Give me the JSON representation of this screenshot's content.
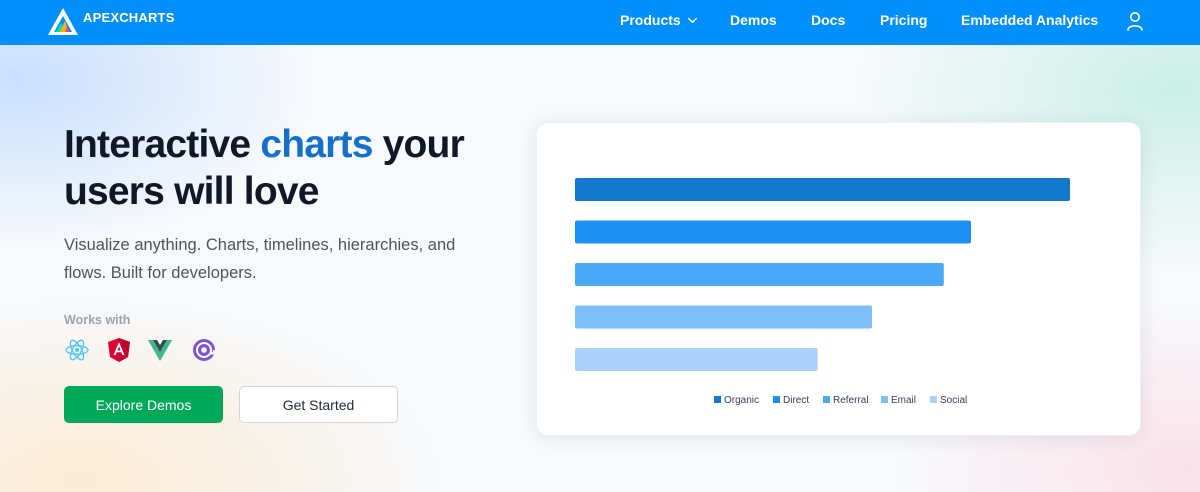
{
  "navbar": {
    "brand_name": "APEXCHARTS",
    "links": [
      {
        "label": "Products",
        "has_dropdown": true
      },
      {
        "label": "Demos"
      },
      {
        "label": "Docs"
      },
      {
        "label": "Pricing"
      },
      {
        "label": "Embedded Analytics"
      }
    ],
    "user_icon": "user-icon"
  },
  "hero": {
    "title_part1": "Interactive ",
    "title_accent": "charts",
    "title_part2": " your users will love",
    "subtitle": "Visualize anything. Charts, timelines, hierarchies, and flows. Built for developers.",
    "works_with_label": "Works with",
    "frameworks": [
      "react-icon",
      "angular-icon",
      "vue-icon",
      "blazor-icon"
    ],
    "primary_button": "Explore Demos",
    "secondary_button": "Get Started"
  },
  "colors": {
    "nav_bg": "#008ffb",
    "accent_text": "#1570c9",
    "primary_button": "#00a85a"
  },
  "chart_data": {
    "type": "bar",
    "orientation": "horizontal",
    "categories": [
      "Organic",
      "Direct",
      "Referral",
      "Email",
      "Social"
    ],
    "values": [
      100,
      80,
      74.5,
      60,
      49
    ],
    "colors": [
      "#1479cc",
      "#1e90f5",
      "#4aa9f7",
      "#7dbff9",
      "#abd0fb"
    ],
    "legend": [
      "Organic",
      "Direct",
      "Referral",
      "Email",
      "Social"
    ],
    "legend_position": "bottom",
    "grid": false,
    "xlim": [
      0,
      100
    ]
  }
}
